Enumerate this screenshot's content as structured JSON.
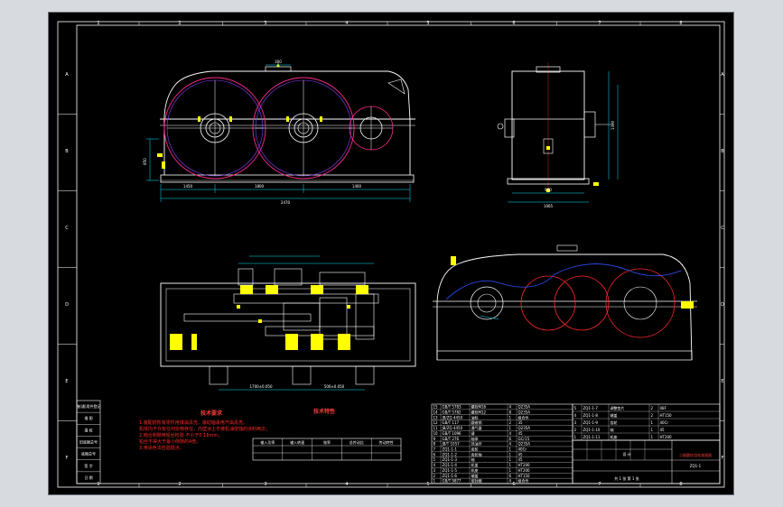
{
  "zones_top": [
    "1",
    "2",
    "3",
    "4",
    "5",
    "6",
    "7",
    "8"
  ],
  "zones_side": [
    "A",
    "B",
    "C",
    "D",
    "E",
    "F"
  ],
  "dimensions": {
    "front_segments": [
      "1450",
      "1800",
      "1460"
    ],
    "front_total": "2470",
    "front_height": "850",
    "side_width": "980",
    "side_total": "1065",
    "side_height": "1390",
    "plan_bottom": [
      "1700±0.050",
      "500±0.050"
    ],
    "top_small": "300"
  },
  "tech_req_title": "技术要求",
  "tech_req_lines": [
    "1.装配前所有零件用煤油清洗，滚动轴承用汽油清洗，",
    "机体内不许有任何杂物存在，内壁涂上不被机油侵蚀的涂料两次；",
    "2.啮合侧隙用铅丝检验 不小于0.16mm，",
    "铅丝不得大于最小侧隙的4倍。",
    "3.用涂色法检验斑点。"
  ],
  "tech_spec_title": "技术特性",
  "tech_spec_headers": [
    "输入功率",
    "输入转速",
    "效率",
    "总传动比",
    "传动特性"
  ],
  "left_stamp": [
    "借(通)用件登记",
    "描 图",
    "描 校",
    "旧底图总号",
    "底图总号",
    "签 字",
    "日 期"
  ],
  "bom_rows": [
    [
      "15",
      "GB/T 5783",
      "螺栓M16",
      "4",
      "Q235A"
    ],
    [
      "14",
      "GB/T 5782",
      "螺栓M12",
      "8",
      "Q235A"
    ],
    [
      "13",
      "JB/ZQ 4450",
      "油标",
      "1",
      "组合件"
    ],
    [
      "12",
      "GB/T 117",
      "圆锥销",
      "2",
      "35"
    ],
    [
      "11",
      "JB/ZQ 4450",
      "通气器",
      "1",
      "Q235A"
    ],
    [
      "10",
      "GB/T 1096",
      "键",
      "4",
      "45"
    ],
    [
      "9",
      "GB/T 276",
      "轴承",
      "6",
      "GCr15"
    ],
    [
      "8",
      "JB/T 1057",
      "挡油环",
      "4",
      "Q235A"
    ],
    [
      "7",
      "ZQ1-1-1",
      "齿轮",
      "1",
      "40Cr"
    ],
    [
      "6",
      "ZQ1-1-2",
      "齿轮轴",
      "1",
      "45"
    ],
    [
      "5",
      "ZQ1-1-3",
      "轴",
      "1",
      "45"
    ],
    [
      "4",
      "ZQ1-1-4",
      "机盖",
      "1",
      "HT200"
    ],
    [
      "3",
      "ZQ1-1-5",
      "机座",
      "1",
      "HT200"
    ],
    [
      "2",
      "ZQ1-1-6",
      "端盖",
      "6",
      "HT150"
    ],
    [
      "1",
      "GB/T 9877",
      "密封圈",
      "4",
      "组合件"
    ]
  ],
  "bom_right_rows": [
    [
      "5",
      "ZQ1-1-7",
      "调整垫片",
      "2",
      "08F"
    ],
    [
      "4",
      "ZQ1-1-8",
      "端盖",
      "2",
      "HT150"
    ],
    [
      "3",
      "ZQ1-1-9",
      "齿轮",
      "1",
      "40Cr"
    ],
    [
      "2",
      "ZQ1-1-10",
      "轴",
      "1",
      "45"
    ],
    [
      "1",
      "ZQ1-1-11",
      "机座",
      "1",
      "HT200"
    ]
  ],
  "title_block": {
    "design": "设 计",
    "company": "二级圆柱齿轮减速器",
    "name": "ZQ1-1",
    "sheet": "共 1 张 第 1 张"
  },
  "colors": {
    "background": "#000000",
    "line": "#ffffff",
    "gear": "#ff2a8c",
    "pitch": "#8c3cff",
    "dimension": "#00e5ff",
    "highlight": "#ffff00",
    "border": "#ffffff",
    "note": "#ff2a2a",
    "blue": "#3050ff"
  }
}
